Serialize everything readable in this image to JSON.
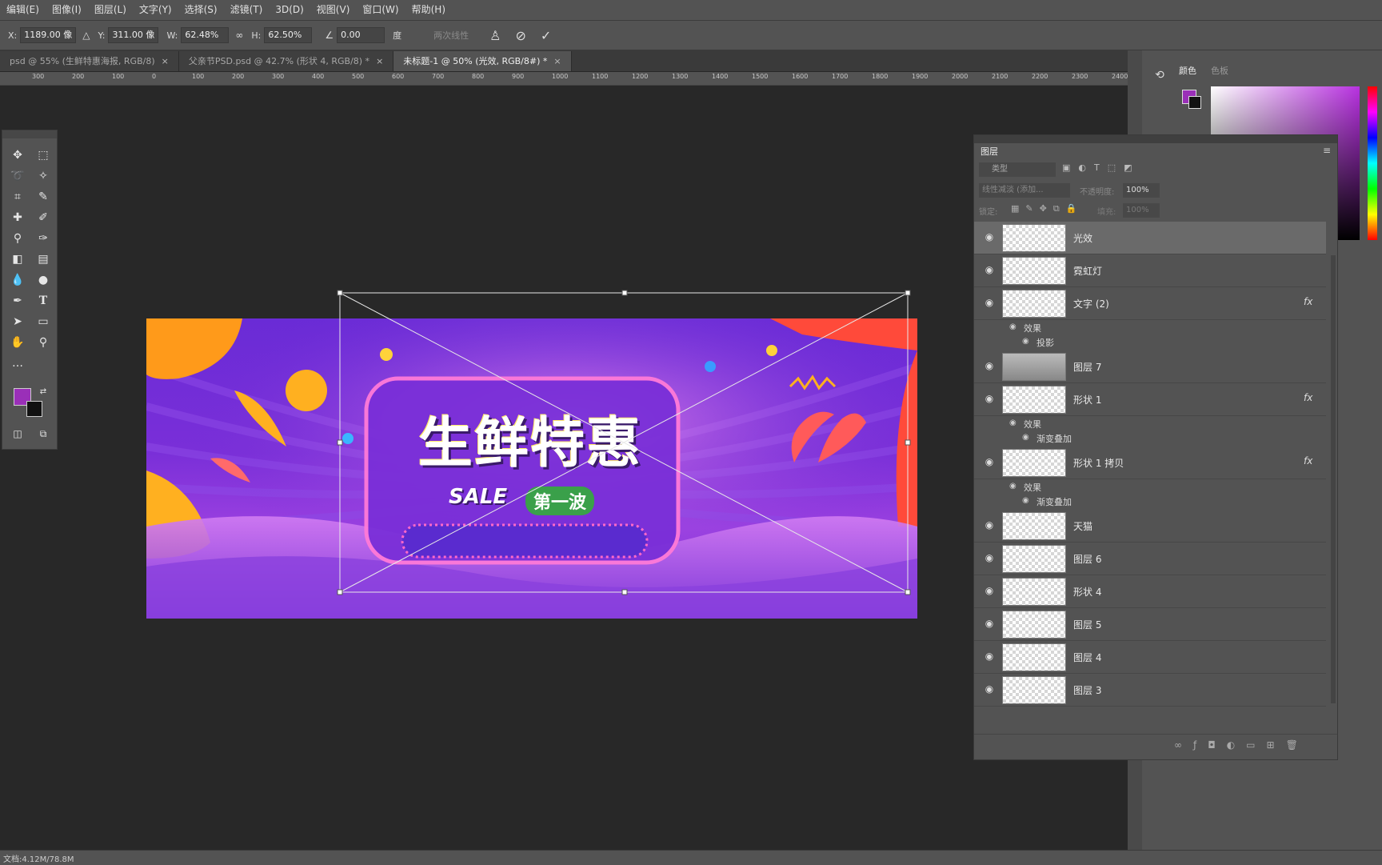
{
  "menu": [
    "编辑(E)",
    "图像(I)",
    "图层(L)",
    "文字(Y)",
    "选择(S)",
    "滤镜(T)",
    "3D(D)",
    "视图(V)",
    "窗口(W)",
    "帮助(H)"
  ],
  "options": {
    "x_label": "X:",
    "x_value": "1189.00 像",
    "y_label": "Y:",
    "y_value": "311.00 像",
    "w_label": "W:",
    "w_value": "62.48%",
    "h_label": "H:",
    "h_value": "62.50%",
    "angle_value": "0.00",
    "angle_unit": "度",
    "interp_label": "两次线性",
    "cancel_icon": "cancel-icon",
    "commit_icon": "commit-icon"
  },
  "tabs": [
    {
      "label": "psd @ 55% (生鲜特惠海报, RGB/8)",
      "active": false
    },
    {
      "label": "父亲节PSD.psd @ 42.7% (形状 4, RGB/8) *",
      "active": false
    },
    {
      "label": "未标题-1 @ 50% (光效, RGB/8#) *",
      "active": true
    }
  ],
  "ruler_ticks": [
    "300",
    "200",
    "100",
    "0",
    "100",
    "200",
    "300",
    "400",
    "500",
    "600",
    "700",
    "800",
    "900",
    "1000",
    "1100",
    "1200",
    "1300",
    "1400",
    "1500",
    "1600",
    "1700",
    "1800",
    "1900",
    "2000",
    "2100",
    "2200",
    "2300",
    "2400"
  ],
  "canvas": {
    "headline": "生鲜特惠",
    "sale": "SALE",
    "subline": "第一波"
  },
  "colors": {
    "foreground": "#9a2fb8",
    "background": "#111111",
    "accent": "#8a3ad8"
  },
  "color_panel": {
    "tab1": "颜色",
    "tab2": "色板"
  },
  "layers_panel": {
    "title": "图层",
    "kind_filter": "类型",
    "blend_mode": "线性减淡 (添加...",
    "opacity_label": "不透明度:",
    "opacity_value": "100%",
    "lock_label": "锁定:",
    "fill_label": "填充:",
    "fill_value": "100%",
    "layers": [
      {
        "name": "光效",
        "selected": true,
        "fx": false
      },
      {
        "name": "霓虹灯",
        "selected": false,
        "fx": false
      },
      {
        "name": "文字 (2)",
        "selected": false,
        "fx": true,
        "effects_label": "效果",
        "effects": [
          "投影"
        ]
      },
      {
        "name": "图层 7",
        "selected": false,
        "fx": false
      },
      {
        "name": "形状 1",
        "selected": false,
        "fx": true,
        "effects_label": "效果",
        "effects": [
          "渐变叠加"
        ]
      },
      {
        "name": "形状 1 拷贝",
        "selected": false,
        "fx": true,
        "effects_label": "效果",
        "effects": [
          "渐变叠加"
        ]
      },
      {
        "name": "天猫",
        "selected": false,
        "fx": false
      },
      {
        "name": "图层 6",
        "selected": false,
        "fx": false
      },
      {
        "name": "形状 4",
        "selected": false,
        "fx": false
      },
      {
        "name": "图层 5",
        "selected": false,
        "fx": false
      },
      {
        "name": "图层 4",
        "selected": false,
        "fx": false
      },
      {
        "name": "图层 3",
        "selected": false,
        "fx": false
      }
    ],
    "fx_symbol": "fx"
  },
  "status": {
    "doc": "文档:4.12M/78.8M"
  }
}
